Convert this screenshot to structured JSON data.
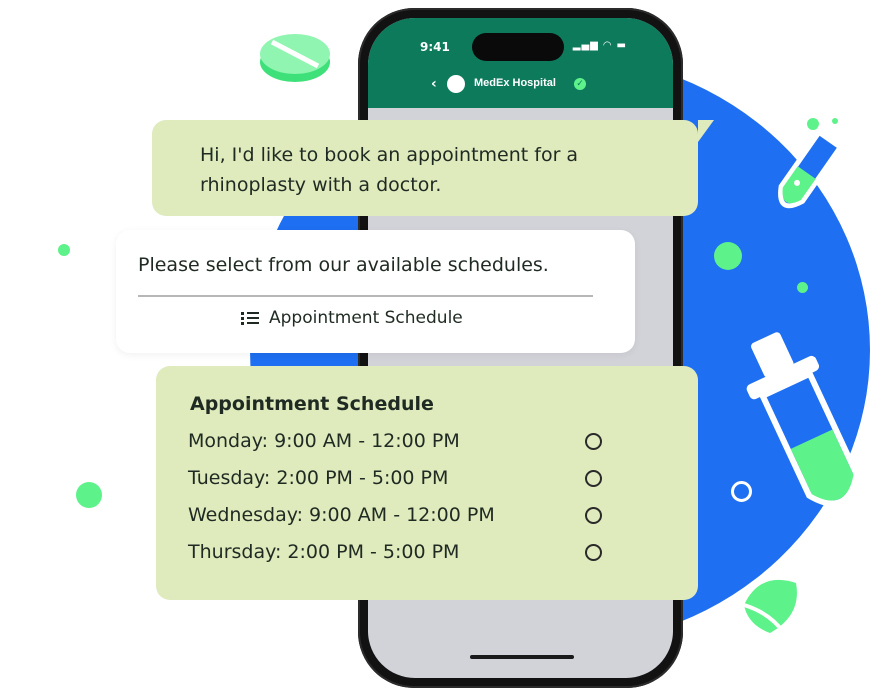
{
  "colors": {
    "brand_green": "#0e7a5c",
    "accent_blue": "#1e6ff1",
    "mint": "#5ef28a",
    "bubble_green": "#dfeabd"
  },
  "status_bar": {
    "time": "9:41",
    "icons": [
      "signal-icon",
      "wifi-icon",
      "battery-icon"
    ]
  },
  "chat_header": {
    "back_icon": "chevron-left-icon",
    "title": "MedEx Hospital",
    "verified_icon": "verified-check-icon"
  },
  "user_message": {
    "text": "Hi, I'd like to book an appointment for a rhinoplasty with a doctor."
  },
  "bot_message": {
    "text": "Please select from our available schedules.",
    "button_icon": "list-icon",
    "button_label": "Appointment Schedule"
  },
  "schedule": {
    "title": "Appointment Schedule",
    "options": [
      {
        "label": "Monday: 9:00 AM - 12:00 PM",
        "selected": false
      },
      {
        "label": "Tuesday: 2:00 PM - 5:00 PM",
        "selected": false
      },
      {
        "label": "Wednesday: 9:00 AM - 12:00 PM",
        "selected": false
      },
      {
        "label": "Thursday: 2:00 PM - 5:00 PM",
        "selected": false
      }
    ]
  }
}
